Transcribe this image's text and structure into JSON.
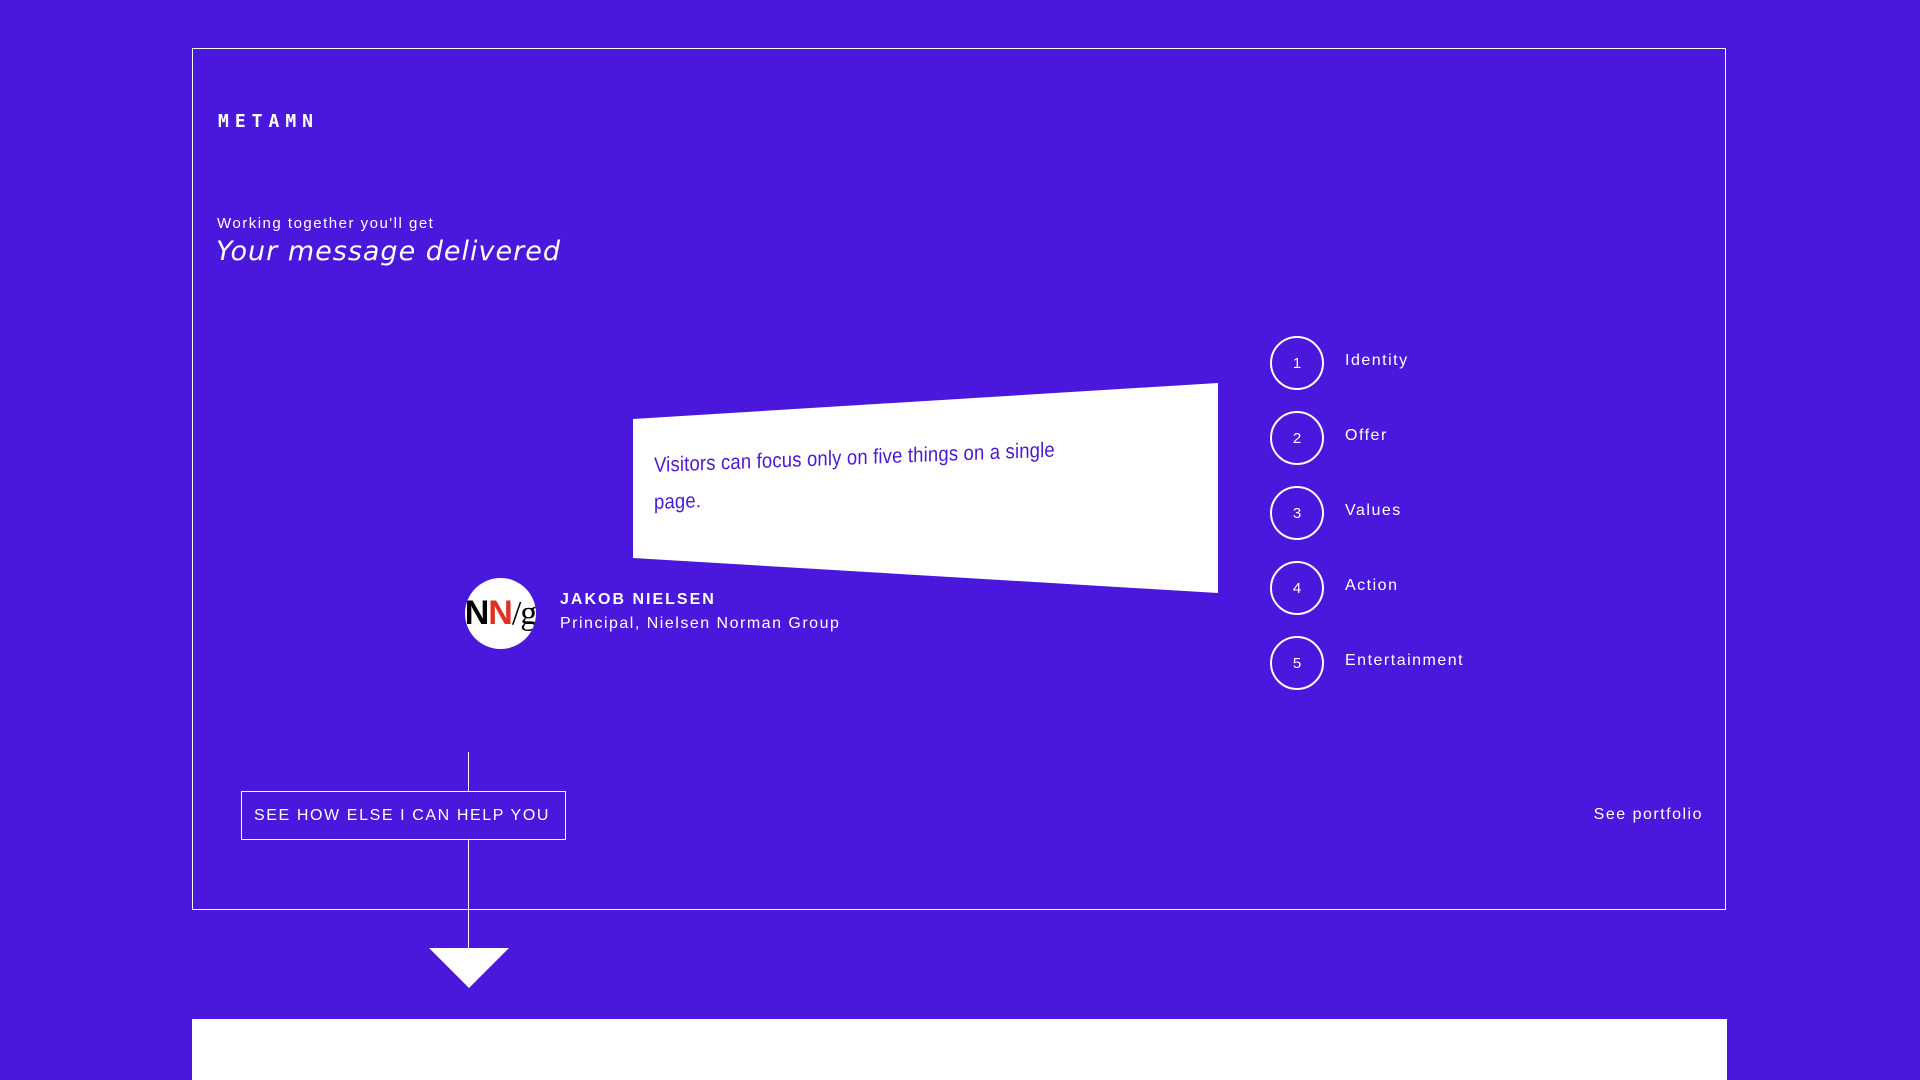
{
  "brand": {
    "logo": "METAMN"
  },
  "hero": {
    "eyebrow": "Working together you'll get",
    "headline": "Your message delivered"
  },
  "quote": {
    "text": "Visitors can focus only on five things on a single page.",
    "author_name": "JAKOB NIELSEN",
    "author_role": "Principal, Nielsen Norman Group",
    "avatar": {
      "letters": [
        "N",
        "N",
        "/",
        "g"
      ],
      "colors": [
        "#000000",
        "#e0301e",
        "#000000",
        "#000000"
      ]
    }
  },
  "steps": [
    {
      "number": "1",
      "label": "Identity"
    },
    {
      "number": "2",
      "label": "Offer"
    },
    {
      "number": "3",
      "label": "Values"
    },
    {
      "number": "4",
      "label": "Action"
    },
    {
      "number": "5",
      "label": "Entertainment"
    }
  ],
  "actions": {
    "cta_label": "SEE HOW ELSE I CAN HELP YOU",
    "portfolio_label": "See portfolio"
  },
  "colors": {
    "background": "#4a17dc",
    "foreground": "#ffffff",
    "accent_red": "#e0301e"
  }
}
